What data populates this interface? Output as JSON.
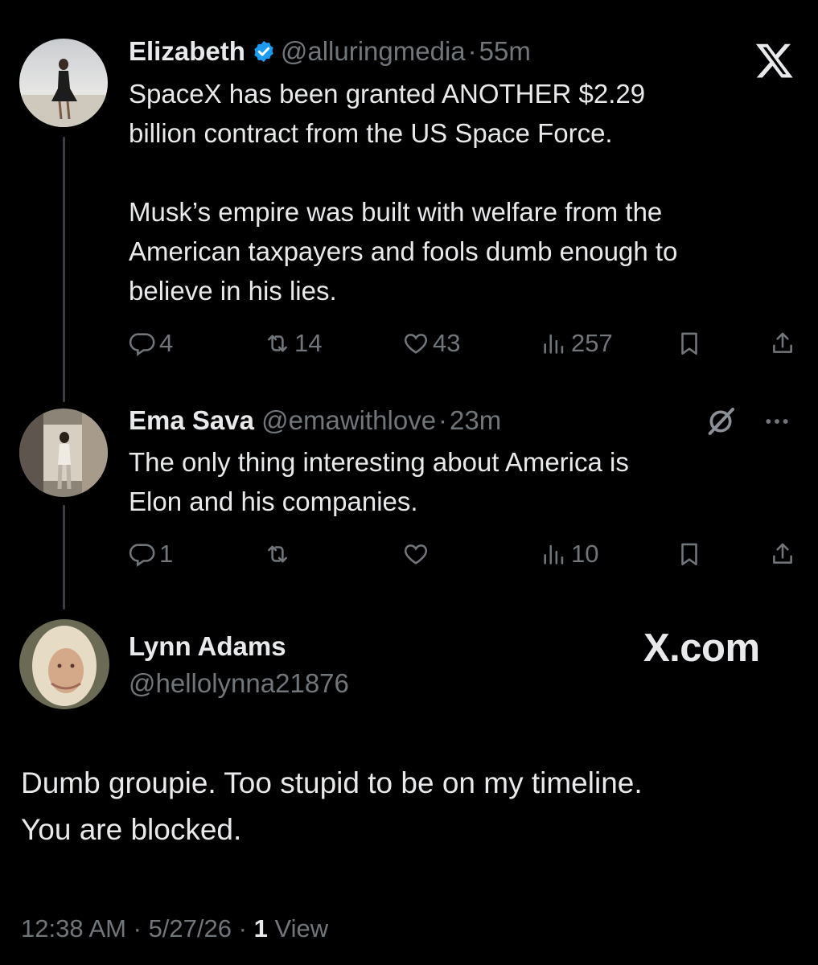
{
  "tweets": [
    {
      "name": "Elizabeth",
      "verified": true,
      "handle": "@alluringmedia",
      "separator": "·",
      "time": "55m",
      "text": "SpaceX has been granted ANOTHER $2.29\nbillion contract from the US Space Force.\n\nMusk’s empire was built with welfare from the\nAmerican taxpayers and fools dumb enough to\nbelieve in his lies.",
      "replies": "4",
      "reposts": "14",
      "likes": "43",
      "views": "257"
    },
    {
      "name": "Ema Sava",
      "handle": "@emawithlove",
      "separator": "·",
      "time": "23m",
      "text": "The only thing interesting about America is\nElon and his companies.",
      "replies": "1",
      "reposts": "",
      "likes": "",
      "views": "10"
    }
  ],
  "reply": {
    "name": "Lynn Adams",
    "handle": "@hellolynna21876",
    "text": "Dumb groupie. Too stupid to be on my timeline.\nYou are blocked.",
    "time": "12:38 AM",
    "separator": "·",
    "date": "5/27/26",
    "view_count": "1",
    "view_label": "View"
  },
  "branding": {
    "site": "X.com"
  },
  "colors": {
    "background": "#000000",
    "text": "#e7e9ea",
    "muted": "#71767b",
    "verified": "#1d9bf0",
    "thread_line": "#3b3f43"
  },
  "icons": [
    "x-logo-icon",
    "verified-badge-icon",
    "reply-icon",
    "repost-icon",
    "like-icon",
    "views-icon",
    "bookmark-icon",
    "share-icon",
    "grok-icon",
    "more-icon"
  ]
}
